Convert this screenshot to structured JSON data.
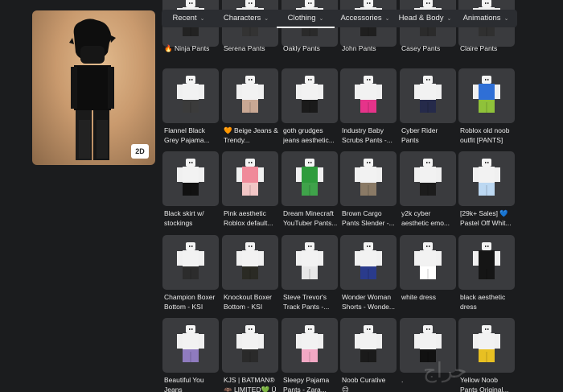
{
  "avatar_panel": {
    "view_toggle": "2D"
  },
  "tabs": [
    {
      "label": "Recent",
      "active": false
    },
    {
      "label": "Characters",
      "active": false
    },
    {
      "label": "Clothing",
      "active": true
    },
    {
      "label": "Accessories",
      "active": false
    },
    {
      "label": "Head & Body",
      "active": false
    },
    {
      "label": "Animations",
      "active": false
    }
  ],
  "items": [
    {
      "name": "🔥 Ninja Pants",
      "pants": "#222222"
    },
    {
      "name": "Serena Pants",
      "pants": "#333333"
    },
    {
      "name": "Oakly Pants",
      "pants": "#2a2a2a"
    },
    {
      "name": "John Pants",
      "pants": "#1f1f1f"
    },
    {
      "name": "Casey Pants",
      "pants": "#2b2b2b"
    },
    {
      "name": "Claire Pants",
      "pants": "#303030"
    },
    {
      "name": "Flannel Black\nGrey Pajama...",
      "pants": "#3b3b3b"
    },
    {
      "name": "🧡 Beige Jeans &\nTrendy...",
      "pants": "#c9a894"
    },
    {
      "name": "goth grudges\njeans aesthetic...",
      "pants": "#1a1a1a"
    },
    {
      "name": "Industry Baby\nScrubs Pants -...",
      "pants": "#e6338a"
    },
    {
      "name": "Cyber Rider\nPants",
      "pants": "#252a4a"
    },
    {
      "name": "Roblox old noob\noutfit [PANTS]",
      "pants": "#8fc23a",
      "shirt": "#2f6fd6"
    },
    {
      "name": "Black skirt w/\nstockings",
      "pants": "#111111"
    },
    {
      "name": "Pink aesthetic\nRoblox default...",
      "pants": "#f2c6c6",
      "shirt": "#f08a9a"
    },
    {
      "name": "Dream Minecraft\nYouTuber Pants...",
      "pants": "#3fa34a",
      "shirt": "#2e9c3c"
    },
    {
      "name": "Brown Cargo\nPants Slender -...",
      "pants": "#8a7a66"
    },
    {
      "name": "y2k cyber\naesthetic emo...",
      "pants": "#1c1c1c"
    },
    {
      "name": "[29k+ Sales] 💙\nPastel Off Whit...",
      "pants": "#bcd8f2"
    },
    {
      "name": "Champion Boxer\nBottom - KSI",
      "pants": "#2c2c2c"
    },
    {
      "name": "Knockout Boxer\nBottom - KSI",
      "pants": "#2a2a24"
    },
    {
      "name": "Steve Trevor's\nTrack Pants -...",
      "pants": "#e8e8e8"
    },
    {
      "name": "Wonder Woman\nShorts - Wonde...",
      "pants": "#2a3b8c"
    },
    {
      "name": "white dress",
      "pants": "#ffffff"
    },
    {
      "name": "black aesthetic\ndress",
      "pants": "#151515",
      "shirt": "#151515"
    },
    {
      "name": "Beautiful You\nJeans",
      "pants": "#8f7bbf"
    },
    {
      "name": "KJS | BATMAN®\n🦇 LIMITED💚 Ü",
      "pants": "#2a2a2a"
    },
    {
      "name": "Sleepy Pajama\nPants - Zara...",
      "pants": "#f2a8c4"
    },
    {
      "name": "Noob Curative\n😊",
      "pants": "#1a1a1a"
    },
    {
      "name": ".",
      "pants": "#111111"
    },
    {
      "name": "Yellow Noob\nPants Original...",
      "pants": "#e8c022"
    }
  ]
}
